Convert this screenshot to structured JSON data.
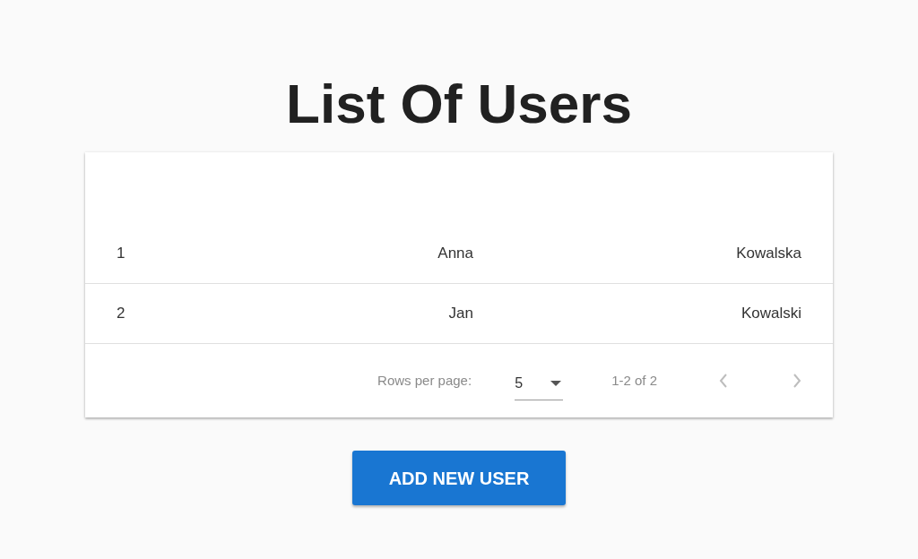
{
  "title": "List Of Users",
  "table": {
    "rows": [
      {
        "cells": [
          "1",
          "Anna",
          "Kowalska"
        ]
      },
      {
        "cells": [
          "2",
          "Jan",
          "Kowalski"
        ]
      }
    ]
  },
  "pagination": {
    "rows_per_page_label": "Rows per page:",
    "rows_per_page": "5",
    "range": "1-2 of 2",
    "previous": {
      "disabled": true
    },
    "next": {
      "disabled": true
    }
  },
  "add_button": {
    "label": "ADD NEW USER"
  }
}
